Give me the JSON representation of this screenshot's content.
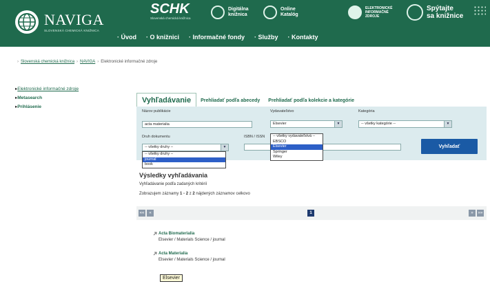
{
  "header": {
    "brand_name": "NAVIGA",
    "brand_sub": "SLOVENSKÁ CHEMICKÁ KNIŽNICA",
    "partners": {
      "schk_name": "SCHK",
      "schk_sub": "Slovenská chemická knižnica",
      "kniznica_l1": "Digitálna",
      "kniznica_l2": "knižnica",
      "katalog_l1": "Online",
      "katalog_l2": "Katalóg",
      "zdroje_l1": "ELEKTRONICKÉ",
      "zdroje_l2": "INFORMAČNÉ",
      "zdroje_l3": "ZDROJE",
      "spytajte_l1": "Spýtajte",
      "spytajte_l2": "sa knižnice"
    },
    "nav": [
      "Úvod",
      "O knižnici",
      "Informačné fondy",
      "Služby",
      "Kontakty"
    ]
  },
  "breadcrumb": {
    "item1": "Slovenská chemická knižnica",
    "item2": "NAVIGA",
    "current": "Elektronické informačné zdroje"
  },
  "sidebar": {
    "item1": "Elektronické informačné zdroje",
    "item2": "Metasearch",
    "item3": "Prihlásenie"
  },
  "tabs": {
    "active": "Vyhľadávanie",
    "tab2": "Prehliadať podľa abecedy",
    "tab3": "Prehliadať podľa kolekcie a kategórie"
  },
  "search": {
    "label_title": "Názov publikácie",
    "title_value": "acta materialia",
    "label_publisher": "Vydavateľstvo",
    "publisher_value": "Elsevier",
    "label_category": "Kategória",
    "category_value": "-- všetky kategórie --",
    "label_doctype": "Druh dokumentu",
    "doctype_value": "-- všetky druhy --",
    "label_isbn": "ISBN / ISSN",
    "isbn_value": "",
    "search_button": "Vyhľadať"
  },
  "doctype_dropdown": [
    "-- všetky druhy --",
    "journal",
    "book"
  ],
  "doctype_selected": "journal",
  "publisher_dropdown": [
    "-- všetky vydavateľstvá --",
    "EBSCO",
    "Elsevier",
    "Springer",
    "Wiley"
  ],
  "publisher_selected": "Elsevier",
  "results": {
    "heading": "Výsledky vyhľadávania",
    "line1": "Vyhľadávanie podľa zadaných kritérií",
    "line2_prefix": "Zobrazujem záznamy",
    "range": "1 - 2",
    "line2_mid": "z",
    "total": "2",
    "line2_suffix": "nájdených záznamov celkovo",
    "current_page": "1",
    "pager_first": "««",
    "pager_prev": "«",
    "pager_next": "»",
    "pager_last": "»»",
    "items": [
      {
        "title": "Acta Biomaterialia",
        "meta": "Elsevier / Materials Science / journal"
      },
      {
        "title": "Acta Materialia",
        "meta": "Elsevier / Materials Science / journal"
      }
    ]
  },
  "tooltip": "Elsevier",
  "colors": {
    "header_green": "#1f6a4d",
    "search_panel": "#dcebee",
    "button_blue": "#1a5aa5",
    "dropdown_highlight": "#2d5fc7"
  }
}
